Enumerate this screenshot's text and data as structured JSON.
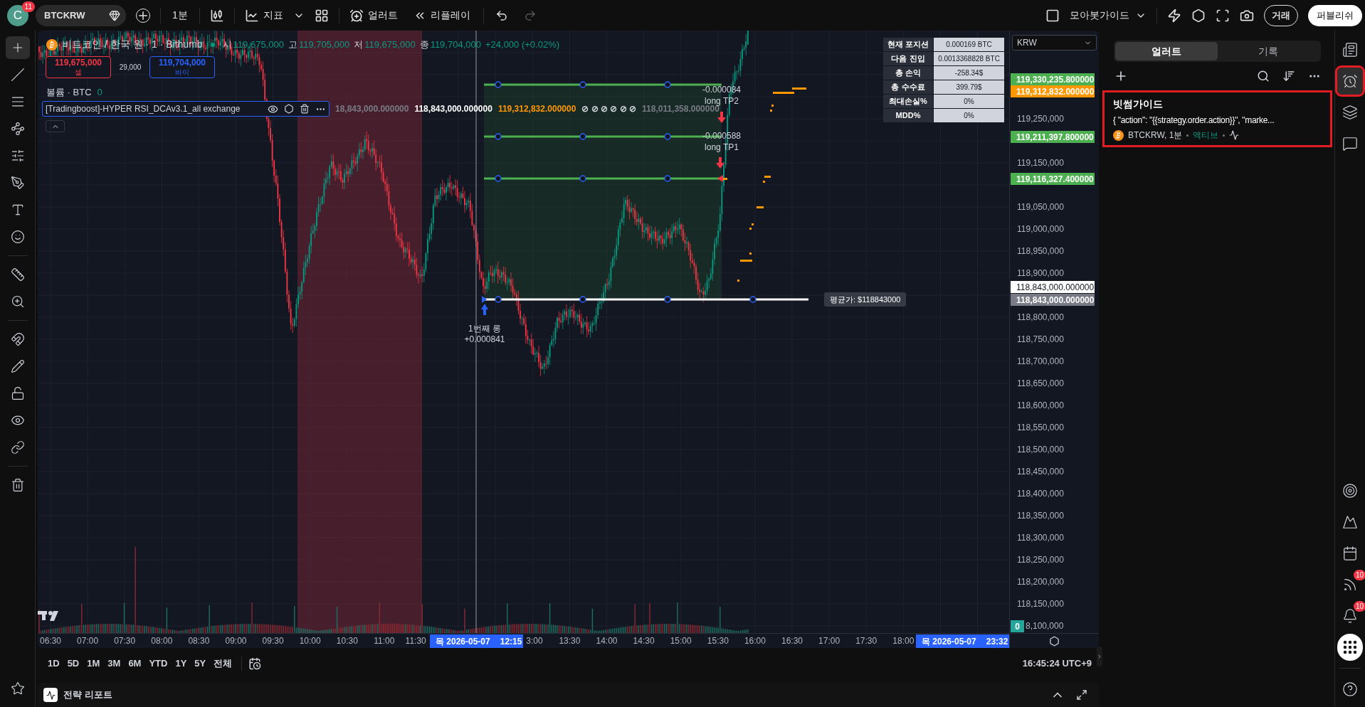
{
  "top_bar": {
    "avatar": "C",
    "avatar_badge": "11",
    "symbol": "BTCKRW",
    "interval": "1분",
    "indicators": "지표",
    "alerts": "얼러트",
    "replay": "리플레이",
    "layout_name": "모아봇가이드",
    "trade": "거래",
    "publish": "퍼블리쉬"
  },
  "left_toolbar": {
    "tools": [
      {
        "selected": true
      },
      {
        "selected": false
      },
      {
        "selected": false
      },
      {
        "selected": false
      },
      {
        "selected": false
      },
      {
        "selected": false
      },
      {
        "selected": false
      },
      {
        "selected": false
      },
      {
        "selected": false
      },
      {
        "selected": false
      },
      {
        "selected": false
      },
      {
        "selected": false
      },
      {
        "selected": false
      },
      {
        "selected": false
      },
      {
        "selected": false
      },
      {
        "selected": false
      }
    ]
  },
  "chart": {
    "legend": {
      "symbol_name": "비트코인 / 한국 원 · 1 · Bithumb",
      "ohlc": [
        {
          "key": "시",
          "value": "119,675,000"
        },
        {
          "key": "고",
          "value": "119,705,000"
        },
        {
          "key": "저",
          "value": "119,675,000"
        },
        {
          "key": "종",
          "value": "119,704,000"
        }
      ],
      "change": "+24,000 (+0.02%)"
    },
    "sell": {
      "price": "119,675,000",
      "label": "셀"
    },
    "spread": "29,000",
    "buy": {
      "price": "119,704,000",
      "label": "바이"
    },
    "volume": {
      "label": "볼륨 · BTC",
      "value": "0"
    },
    "indicator": {
      "name": "[Tradingboost]-HYPER RSI_DCAv3.1_all exchange",
      "values": [
        {
          "text": "18,843,000.000000",
          "color": "#787b86"
        },
        {
          "text": "118,843,000.000000",
          "color": "#ffffff"
        },
        {
          "text": "119,312,832.000000",
          "color": "#ff9800"
        },
        {
          "text": "⊘ ⊘ ⊘ ⊘ ⊘ ⊘",
          "color": "#d1d4dc"
        },
        {
          "text": "118,011,358.000000",
          "color": "#787b86"
        }
      ]
    },
    "stats_table": [
      {
        "label": "현재 포지션",
        "value": "0.000169 BTC"
      },
      {
        "label": "다음 진입",
        "value": "0.0013368828 BTC"
      },
      {
        "label": "총 손익",
        "value": "-258.34$"
      },
      {
        "label": "총 수수료",
        "value": "399.79$"
      },
      {
        "label": "최대손실%",
        "value": "0%"
      },
      {
        "label": "MDD%",
        "value": "0%"
      }
    ],
    "annotations": {
      "tp2_pnl": "-0.000084",
      "tp2_label": "long TP2",
      "tp1_pnl": "-0.000588",
      "tp1_label": "long TP1",
      "entry_label": "1번째 롱",
      "entry_pnl": "+0.000841",
      "avg_price": "평균가: $118843000"
    },
    "currency_select": "KRW",
    "price_axis": {
      "ticks": [
        "119,250,000",
        "119,150,000",
        "119,050,000",
        "119,000,000",
        "118,950,000",
        "118,900,000",
        "118,800,000",
        "118,750,000",
        "118,700,000",
        "118,650,000",
        "118,600,000",
        "118,550,000",
        "118,500,000",
        "118,450,000",
        "118,400,000",
        "118,350,000",
        "118,300,000",
        "118,250,000",
        "118,200,000",
        "118,150,000",
        "8,100,000"
      ],
      "markers": [
        {
          "text": "119,330,235.800000",
          "color": "#4caf50",
          "kind": "filled"
        },
        {
          "text": "119,312,832.000000",
          "color": "#ff9800",
          "kind": "filled"
        },
        {
          "text": "119,211,397.800000",
          "color": "#4caf50",
          "kind": "filled"
        },
        {
          "text": "119,116,327.400000",
          "color": "#4caf50",
          "kind": "filled"
        },
        {
          "text": "118,843,000.000000",
          "color": "#ffffff",
          "kind": "inverse"
        },
        {
          "text": "118,843,000.000000",
          "color": "#787b86",
          "kind": "filled"
        }
      ],
      "volume_badge": "0"
    },
    "time_axis": {
      "ticks": [
        "06:30",
        "07:00",
        "07:30",
        "08:00",
        "08:30",
        "09:00",
        "09:30",
        "10:00",
        "10:30",
        "11:00",
        "11:30",
        "3:00",
        "13:30",
        "14:00",
        "14:30",
        "15:00",
        "15:30",
        "16:00",
        "16:30",
        "17:00",
        "17:30",
        "18:00"
      ],
      "crosshair_label": {
        "day": "목 2026-05-07",
        "time": "12:15"
      },
      "end_label": {
        "day": "목 2026-05-07",
        "time": "23:32"
      }
    },
    "range_bar": {
      "ranges": [
        "1D",
        "5D",
        "1M",
        "3M",
        "6M",
        "YTD",
        "1Y",
        "5Y",
        "전체"
      ],
      "clock": "16:45:24 UTC+9"
    },
    "strategy_report": {
      "title": "전략 리포트"
    }
  },
  "alerts_panel": {
    "tabs": [
      {
        "label": "얼러트",
        "selected": true
      },
      {
        "label": "기록",
        "selected": false
      }
    ],
    "alerts": [
      {
        "name": "빗썸가이드",
        "message": "{ \"action\": \"{{strategy.order.action}}\", \"marke...",
        "symbol": "BTCKRW, 1분",
        "status": "액티브",
        "highlighted": true
      }
    ]
  },
  "right_rail": {
    "items": [
      {
        "selected": false,
        "highlighted": false
      },
      {
        "selected": true,
        "highlighted": true
      },
      {
        "selected": false,
        "highlighted": false
      },
      {
        "selected": false,
        "highlighted": false
      },
      {
        "selected": false,
        "highlighted": false
      },
      {
        "selected": false,
        "highlighted": false
      },
      {
        "selected": false,
        "highlighted": false
      },
      {
        "selected": false,
        "highlighted": false,
        "badge": "10"
      },
      {
        "selected": false,
        "highlighted": false,
        "badge": "10"
      },
      {
        "selected": false,
        "highlighted": false
      },
      {
        "selected": false,
        "highlighted": false
      }
    ]
  }
}
